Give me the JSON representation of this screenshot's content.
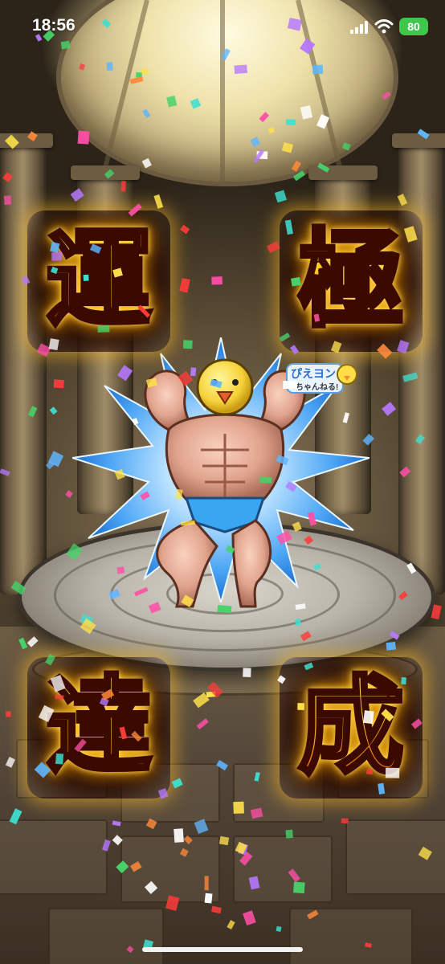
{
  "status_bar": {
    "time": "18:56",
    "battery_level": "80",
    "icons": [
      "cellular-signal-icon",
      "wifi-icon",
      "battery-charging-icon"
    ]
  },
  "banner": {
    "kanji_top_left": "運",
    "kanji_top_right": "極",
    "kanji_bottom_left": "達",
    "kanji_bottom_right": "成"
  },
  "logo": {
    "line1": "ぴえヨン",
    "line2": "ちゃんねる!"
  },
  "colors": {
    "kanji_gold": "#ffcf2a",
    "kanji_outline": "#3a0a00",
    "glow": "#ffb000",
    "burst_blue": "#5fb6ff",
    "battery_green": "#3ec74b"
  }
}
